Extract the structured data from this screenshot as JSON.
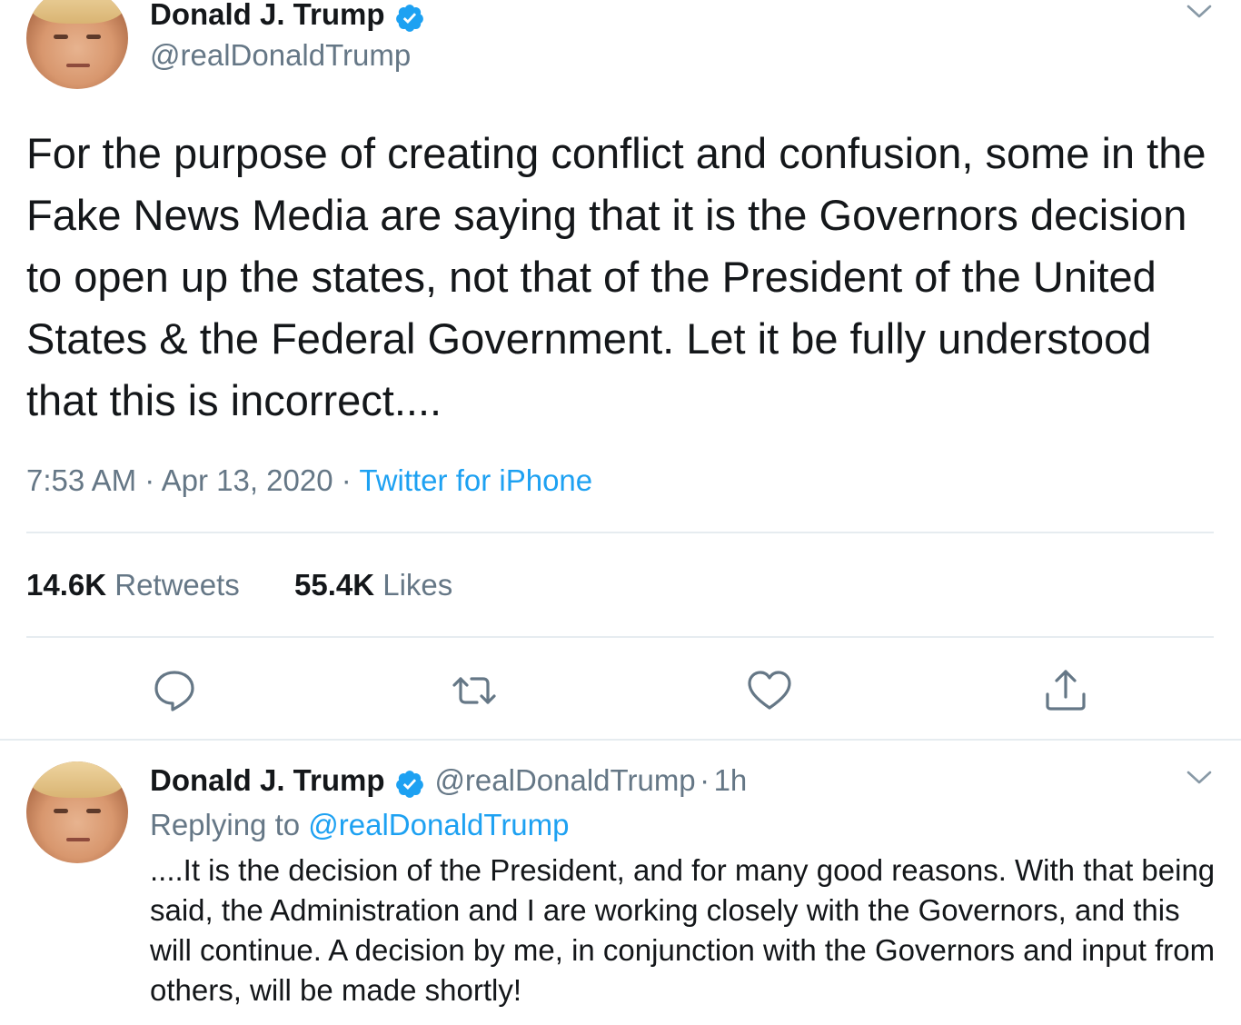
{
  "main_tweet": {
    "author_name": "Donald J. Trump",
    "author_handle": "@realDonaldTrump",
    "text": "For the purpose of creating conflict and confusion, some in the Fake News Media are saying that it is the Governors decision to open up the states, not that of the President of the United States & the Federal Government. Let it be fully understood that this is incorrect....",
    "time": "7:53 AM",
    "separator": "·",
    "date": "Apr 13, 2020",
    "source": "Twitter for iPhone",
    "retweets_count": "14.6K",
    "retweets_label": "Retweets",
    "likes_count": "55.4K",
    "likes_label": "Likes"
  },
  "reply_tweet": {
    "author_name": "Donald J. Trump",
    "author_handle": "@realDonaldTrump",
    "separator": "·",
    "time_ago": "1h",
    "replying_prefix": "Replying to",
    "replying_to": "@realDonaldTrump",
    "text": "....It is the decision of the President, and for many good reasons. With that being said, the Administration and I are working closely with the Governors, and this will continue. A decision by me, in conjunction with the Governors and input from others, will be made shortly!"
  },
  "icons": [
    "verified-icon",
    "chevron-down-icon",
    "reply-icon",
    "retweet-icon",
    "like-icon",
    "share-icon"
  ],
  "colors": {
    "accent": "#1da1f2",
    "secondary_text": "#657786",
    "primary_text": "#14171a",
    "divider": "#e6ecf0"
  }
}
